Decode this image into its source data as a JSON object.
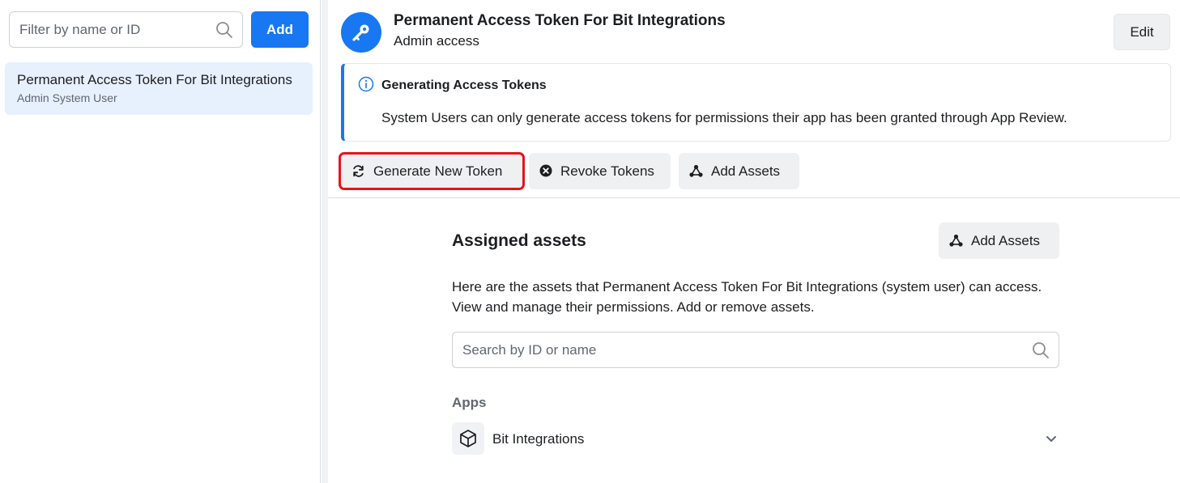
{
  "sidebar": {
    "filter_placeholder": "Filter by name or ID",
    "add_label": "Add",
    "items": [
      {
        "name": "Permanent Access Token For Bit Integrations",
        "role": "Admin System User",
        "selected": true
      }
    ]
  },
  "header": {
    "avatar_icon": "key-icon",
    "title": "Permanent Access Token For Bit Integrations",
    "subtitle": "Admin access",
    "edit_label": "Edit"
  },
  "notice": {
    "icon": "info-icon",
    "title": "Generating Access Tokens",
    "text": "System Users can only generate access tokens for permissions their app has been granted through App Review."
  },
  "actions": {
    "generate_label": "Generate New Token",
    "revoke_label": "Revoke Tokens",
    "add_assets_label": "Add Assets"
  },
  "assets": {
    "title": "Assigned assets",
    "add_label": "Add Assets",
    "description": "Here are the assets that Permanent Access Token For Bit Integrations (system user) can access. View and manage their permissions. Add or remove assets.",
    "search_placeholder": "Search by ID or name",
    "apps_heading": "Apps",
    "apps": [
      {
        "name": "Bit Integrations",
        "icon": "cube-icon"
      }
    ]
  },
  "colors": {
    "accent": "#1877f2",
    "highlight": "#e4141b",
    "selected_bg": "#e7f0fd"
  }
}
